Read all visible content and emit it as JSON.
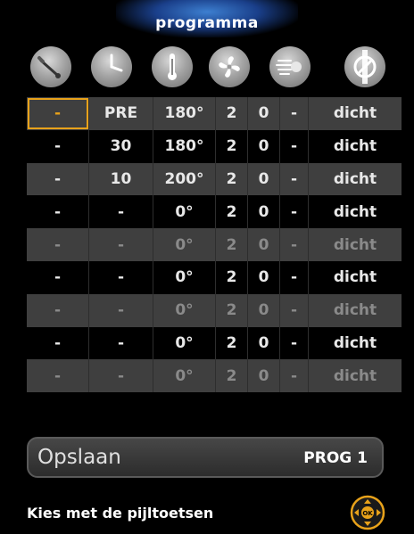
{
  "header": {
    "title": "programma"
  },
  "icons": [
    {
      "name": "meat-probe-icon"
    },
    {
      "name": "clock-icon"
    },
    {
      "name": "thermometer-icon"
    },
    {
      "name": "fan-icon"
    },
    {
      "name": "steam-icon"
    },
    {
      "name": "vent-valve-icon"
    }
  ],
  "table": {
    "rows": [
      {
        "cells": [
          "-",
          "PRE",
          "180°",
          "2",
          "0",
          "-",
          "dicht"
        ],
        "style": "gray",
        "dim": false,
        "selected_col": 0
      },
      {
        "cells": [
          "-",
          "30",
          "180°",
          "2",
          "0",
          "-",
          "dicht"
        ],
        "style": "black",
        "dim": false
      },
      {
        "cells": [
          "-",
          "10",
          "200°",
          "2",
          "0",
          "-",
          "dicht"
        ],
        "style": "gray",
        "dim": false
      },
      {
        "cells": [
          "-",
          "-",
          "0°",
          "2",
          "0",
          "-",
          "dicht"
        ],
        "style": "black",
        "dim": false
      },
      {
        "cells": [
          "-",
          "-",
          "0°",
          "2",
          "0",
          "-",
          "dicht"
        ],
        "style": "gray",
        "dim": true
      },
      {
        "cells": [
          "-",
          "-",
          "0°",
          "2",
          "0",
          "-",
          "dicht"
        ],
        "style": "black",
        "dim": false
      },
      {
        "cells": [
          "-",
          "-",
          "0°",
          "2",
          "0",
          "-",
          "dicht"
        ],
        "style": "gray",
        "dim": true
      },
      {
        "cells": [
          "-",
          "-",
          "0°",
          "2",
          "0",
          "-",
          "dicht"
        ],
        "style": "black",
        "dim": false
      },
      {
        "cells": [
          "-",
          "-",
          "0°",
          "2",
          "0",
          "-",
          "dicht"
        ],
        "style": "gray",
        "dim": true
      }
    ]
  },
  "footer": {
    "save_label": "Opslaan",
    "program_label": "PROG 1",
    "hint": "Kies met de pijltoetsen",
    "nav_button_label": "OK"
  },
  "colors": {
    "accent": "#e8a21a",
    "row_gray": "#3f3f3f",
    "row_black": "#000000"
  }
}
